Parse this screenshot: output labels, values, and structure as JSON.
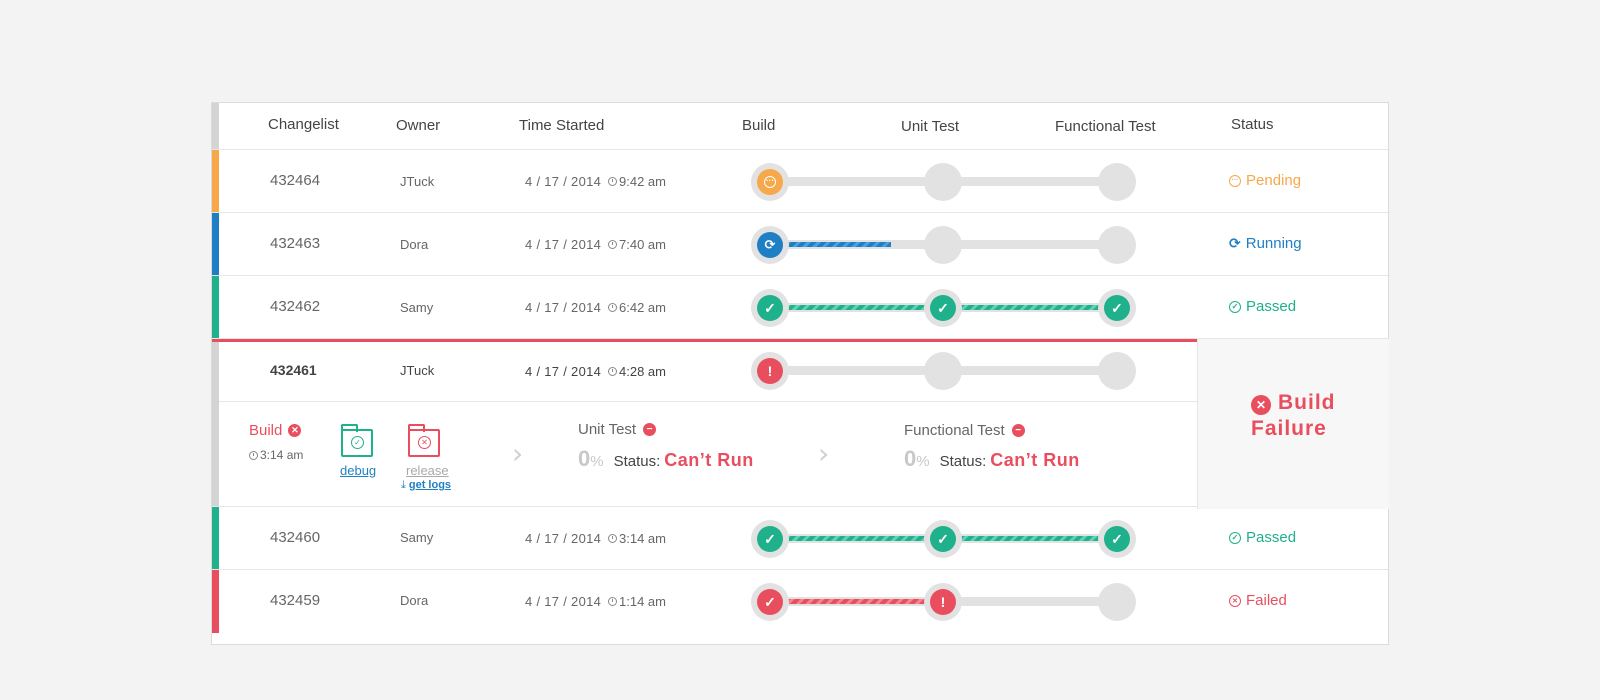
{
  "colors": {
    "pending": "#f6a84a",
    "running": "#1f7fc5",
    "passed": "#1fb08c",
    "failed": "#e94e5e",
    "neutral": "#d4d4d4"
  },
  "header": {
    "changelist": "Changelist",
    "owner": "Owner",
    "time_started": "Time Started",
    "build": "Build",
    "unit_test": "Unit Test",
    "functional_test": "Functional Test",
    "status": "Status"
  },
  "rows": [
    {
      "changelist": "432464",
      "owner": "JTuck",
      "date": "4 / 17 / 2014",
      "time": "9:42 am",
      "status": "Pending",
      "status_icon": "ellipsis-circle-icon"
    },
    {
      "changelist": "432463",
      "owner": "Dora",
      "date": "4 / 17 / 2014",
      "time": "7:40 am",
      "status": "Running",
      "status_icon": "refresh-icon"
    },
    {
      "changelist": "432462",
      "owner": "Samy",
      "date": "4 / 17 / 2014",
      "time": "6:42 am",
      "status": "Passed",
      "status_icon": "check-circle-icon"
    },
    {
      "changelist": "432461",
      "owner": "JTuck",
      "date": "4 / 17 / 2014",
      "time": "4:28 am",
      "status": "Build Failure",
      "status_icon": "times-circle-icon"
    },
    {
      "changelist": "432460",
      "owner": "Samy",
      "date": "4 / 17 / 2014",
      "time": "3:14 am",
      "status": "Passed",
      "status_icon": "check-circle-icon"
    },
    {
      "changelist": "432459",
      "owner": "Dora",
      "date": "4 / 17 / 2014",
      "time": "1:14 am",
      "status": "Failed",
      "status_icon": "times-circle-icon"
    }
  ],
  "running_progress": 0.35,
  "details": {
    "build_label": "Build",
    "build_time": "3:14 am",
    "debug_label": "debug",
    "release_label": "release",
    "get_logs_label": "get logs",
    "unit_test_label": "Unit Test",
    "unit_test_percent": "0",
    "percent_sign": "%",
    "status_label": "Status:",
    "unit_test_status": "Can’t Run",
    "functional_test_label": "Functional Test",
    "functional_test_percent": "0",
    "functional_test_status": "Can’t Run"
  },
  "failure_panel": {
    "line1": "Build",
    "line2": "Failure"
  }
}
